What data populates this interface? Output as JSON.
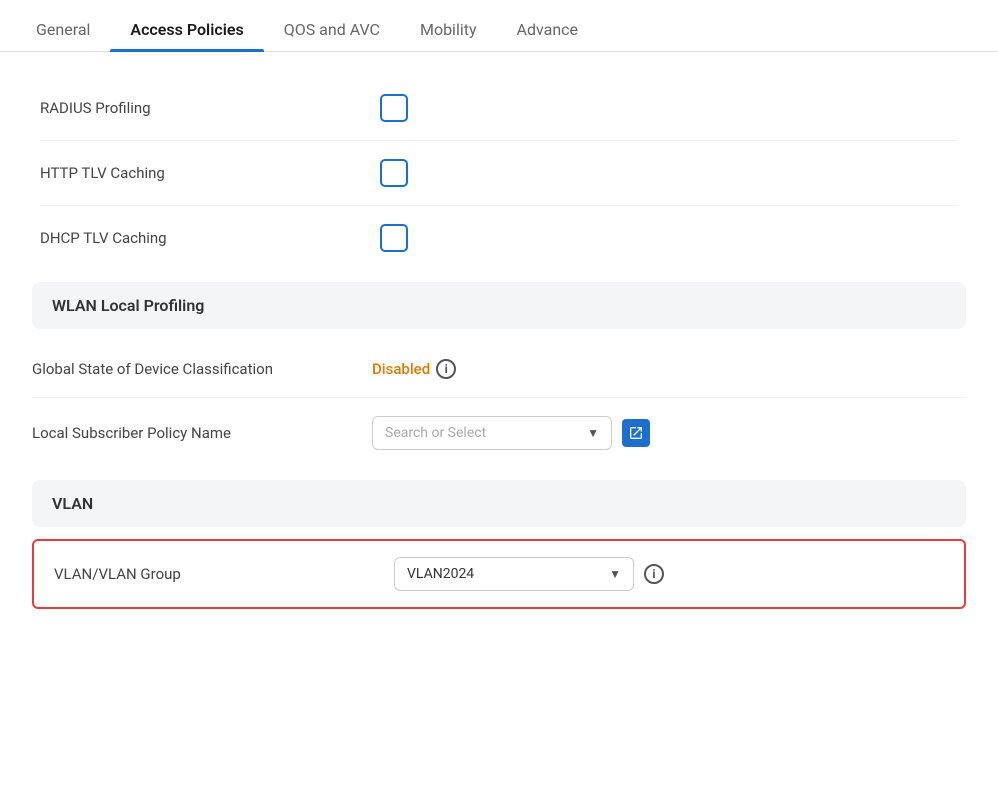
{
  "tabs": [
    {
      "id": "general",
      "label": "General",
      "active": false
    },
    {
      "id": "access-policies",
      "label": "Access Policies",
      "active": true
    },
    {
      "id": "qos-avc",
      "label": "QOS and AVC",
      "active": false
    },
    {
      "id": "mobility",
      "label": "Mobility",
      "active": false
    },
    {
      "id": "advance",
      "label": "Advance",
      "active": false
    }
  ],
  "fields": {
    "radius_profiling": {
      "label": "RADIUS Profiling",
      "checked": false
    },
    "http_tlv_caching": {
      "label": "HTTP TLV Caching",
      "checked": false
    },
    "dhcp_tlv_caching": {
      "label": "DHCP TLV Caching",
      "checked": false
    }
  },
  "sections": {
    "wlan_local_profiling": {
      "title": "WLAN Local Profiling"
    },
    "vlan": {
      "title": "VLAN"
    }
  },
  "global_state": {
    "label": "Global State of Device Classification",
    "status": "Disabled",
    "info_icon": "i"
  },
  "local_subscriber": {
    "label": "Local Subscriber Policy Name",
    "placeholder": "Search or Select"
  },
  "vlan_group": {
    "label": "VLAN/VLAN Group",
    "value": "VLAN2024",
    "info_icon": "i"
  },
  "colors": {
    "accent_blue": "#1d6fce",
    "disabled_orange": "#e07b00",
    "border_red": "#e63e3e",
    "checkbox_border": "#1d6fce"
  }
}
